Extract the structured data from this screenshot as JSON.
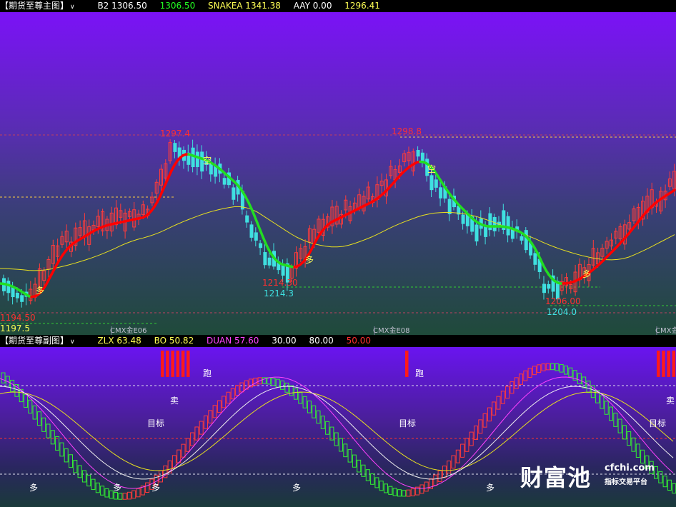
{
  "main_header": {
    "title": "【期货至尊主图】",
    "b2": "B2 1306.50",
    "b2_value": "1306.50",
    "snakea": "SNAKEA 1341.38",
    "aay": "AAY 0.00",
    "last": "1296.41"
  },
  "main_chart": {
    "price_labels": [
      "1297.4",
      "1298.8",
      "1214.30",
      "1214.3",
      "1206.00",
      "1204.0",
      "1194.50",
      "1197.5"
    ],
    "signal_labels": [
      "空",
      "空",
      "多",
      "多",
      "多"
    ],
    "contract_labels": [
      "CMX金E06",
      "CMX金E08",
      "CMX金E"
    ]
  },
  "sub_header": {
    "title": "【期货至尊副图】",
    "zlx": "ZLX 63.48",
    "bo": "BO 50.82",
    "duan": "DUAN 57.60",
    "v1": "30.00",
    "v2": "80.00",
    "v3": "50.00"
  },
  "sub_chart": {
    "run_labels": [
      "跑",
      "跑"
    ],
    "sell_labels": [
      "卖",
      "卖"
    ],
    "target_labels": [
      "目标",
      "目标",
      "目标"
    ],
    "long_labels": [
      "多",
      "多",
      "多",
      "多",
      "多"
    ]
  },
  "watermark": {
    "name": "财富池",
    "url": "cfchi.com",
    "slogan": "指标交易平台"
  },
  "colors": {
    "up": "#ff3b3b",
    "down": "#3fe0e0",
    "snake_up": "#ff0000",
    "snake_down": "#22dd22",
    "ma": "#e8e020",
    "header_green": "#22ff22",
    "header_magenta": "#ff44ff",
    "header_yellow": "#ffff55"
  }
}
